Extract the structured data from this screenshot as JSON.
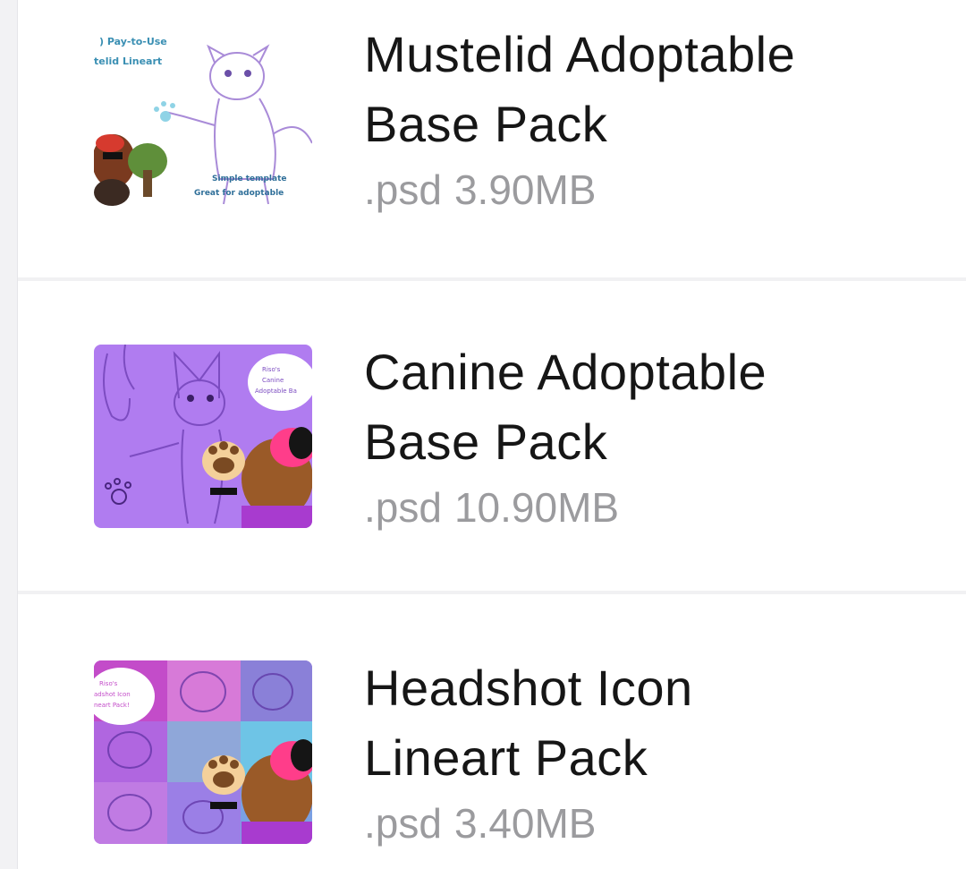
{
  "files": [
    {
      "title_line1": "Mustelid Adoptable",
      "title_line2": "Base Pack",
      "extension": ".psd",
      "size": "3.90MB",
      "thumbnail_icon": "mustelid-lineart-thumbnail"
    },
    {
      "title_line1": "Canine Adoptable",
      "title_line2": "Base Pack",
      "extension": ".psd",
      "size": "10.90MB",
      "thumbnail_icon": "canine-lineart-thumbnail"
    },
    {
      "title_line1": "Headshot Icon",
      "title_line2": "Lineart Pack",
      "extension": ".psd",
      "size": "3.40MB",
      "thumbnail_icon": "headshot-icon-thumbnail"
    }
  ],
  "colors": {
    "title": "#161616",
    "meta": "#9b9b9e",
    "divider": "#f1f1f3",
    "gutter": "#f2f2f4",
    "canine_thumb_bg": "#b07cf0",
    "headshot_thumb_bg": "#a565e8"
  }
}
